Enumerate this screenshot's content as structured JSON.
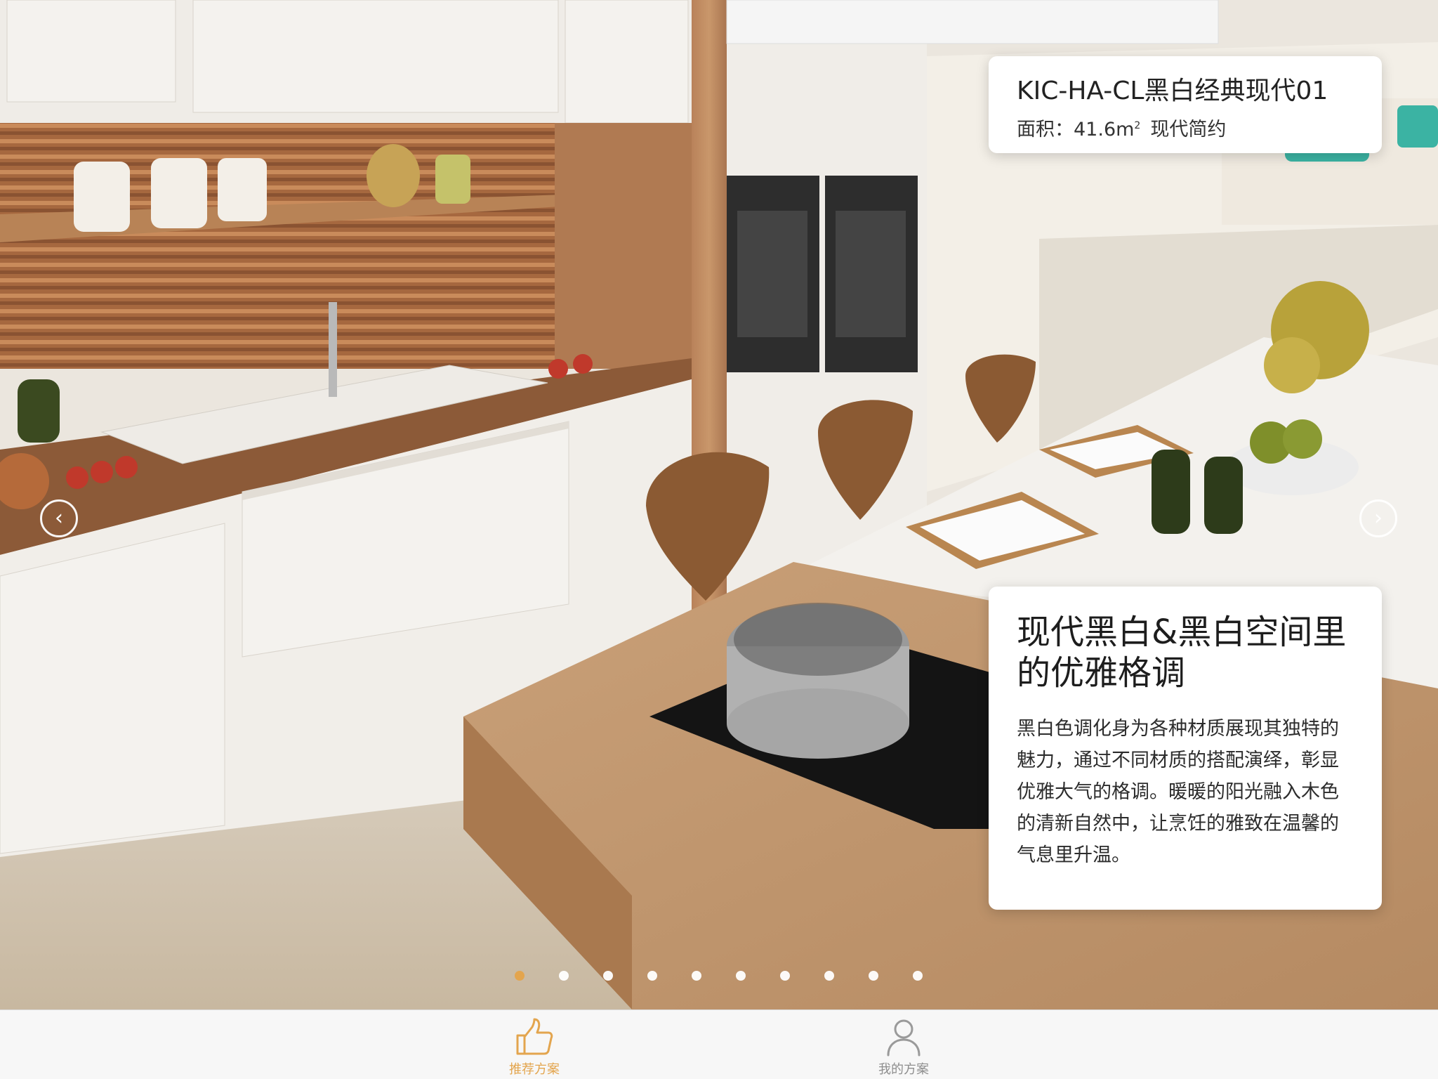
{
  "scheme": {
    "name": "KIC-HA-CL黑白经典现代01",
    "area_label": "面积：41.6m",
    "area_unit_sup": "2",
    "style": "现代简约"
  },
  "description": {
    "headline": "现代黑白&黑白空间里的优雅格调",
    "body": "黑白色调化身为各种材质展现其独特的魅力，通过不同材质的搭配演绎，彰显优雅大气的格调。暖暖的阳光融入木色的清新自然中，让烹饪的雅致在温馨的气息里升温。"
  },
  "carousel": {
    "prev_icon": "chevron-left-icon",
    "next_icon": "chevron-right-icon",
    "prev_glyph": "‹",
    "next_glyph": "›",
    "total_slides": 10,
    "active_index": 0
  },
  "tabs": [
    {
      "label": "推荐方案",
      "icon": "thumbs-up-icon",
      "active": true
    },
    {
      "label": "我的方案",
      "icon": "user-icon",
      "active": false
    }
  ],
  "colors": {
    "accent": "#e3a54e",
    "tab_inactive": "#8e8e8e"
  }
}
